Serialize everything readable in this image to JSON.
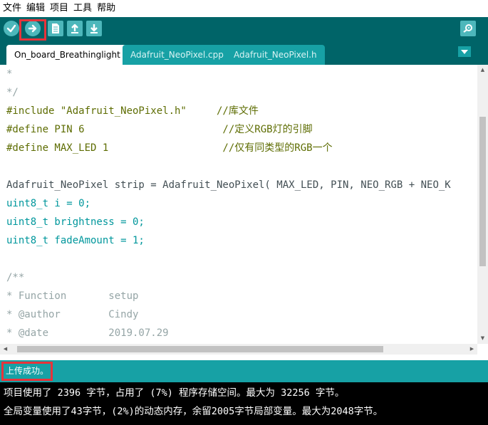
{
  "menu": {
    "items": [
      "文件",
      "编辑",
      "项目",
      "工具",
      "帮助"
    ]
  },
  "toolbar": {
    "buttons": [
      "verify-icon",
      "upload-icon",
      "new-icon",
      "open-icon",
      "save-icon",
      "serial-monitor-icon"
    ],
    "highlight_color": "#e8333a"
  },
  "tabs": [
    "On_board_Breathinglight",
    "Adafruit_NeoPixel.cpp",
    "Adafruit_NeoPixel.h"
  ],
  "editor": {
    "lines": [
      "*",
      "*/",
      "#include \"Adafruit_NeoPixel.h\"     //库文件",
      "#define PIN 6                       //定义RGB灯的引脚",
      "#define MAX_LED 1                   //仅有同类型的RGB一个",
      "",
      "Adafruit_NeoPixel strip = Adafruit_NeoPixel( MAX_LED, PIN, NEO_RGB + NEO_K",
      "uint8_t i = 0;",
      "uint8_t brightness = 0;",
      "uint8_t fadeAmount = 1;",
      "",
      "/**",
      "* Function       setup",
      "* @author        Cindy",
      "* @date          2019.07.29"
    ]
  },
  "status": {
    "message": "上传成功。"
  },
  "console": {
    "lines": [
      "项目使用了 2396 字节，占用了 (7%) 程序存储空间。最大为 32256 字节。",
      "全局变量使用了43字节，(2%)的动态内存，余留2005字节局部变量。最大为2048字节。"
    ]
  },
  "colors": {
    "toolbar_bg": "#006468",
    "tab_inactive": "#17a1a5",
    "status_bg": "#17a1a5",
    "console_bg": "#000000"
  }
}
